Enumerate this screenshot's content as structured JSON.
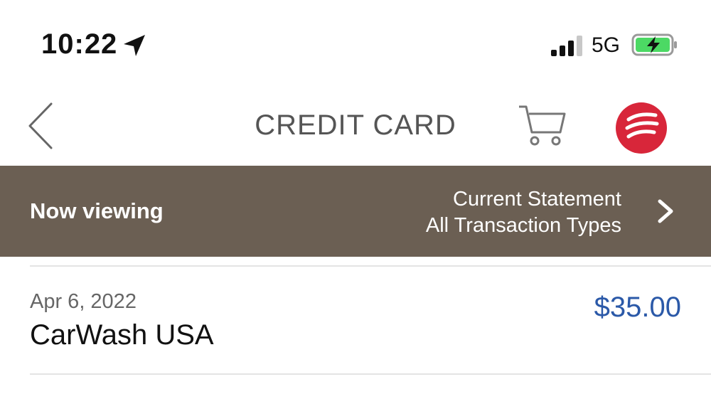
{
  "status_bar": {
    "time": "10:22",
    "network": "5G",
    "icons": [
      "location-arrow-icon",
      "signal-bars-icon",
      "battery-charging-icon"
    ]
  },
  "header": {
    "title": "CREDIT CARD",
    "icons": [
      "back-chevron-icon",
      "shopping-cart-icon",
      "bank-logo-icon"
    ],
    "logo_color": "#d8263a"
  },
  "banner": {
    "label": "Now viewing",
    "line1": "Current Statement",
    "line2": "All Transaction Types",
    "background": "#6b5f53",
    "icon": "chevron-right-icon"
  },
  "transactions": [
    {
      "date": "Apr 6, 2022",
      "merchant": "CarWash USA",
      "amount": "$35.00",
      "amount_color": "#2b59a8"
    }
  ]
}
